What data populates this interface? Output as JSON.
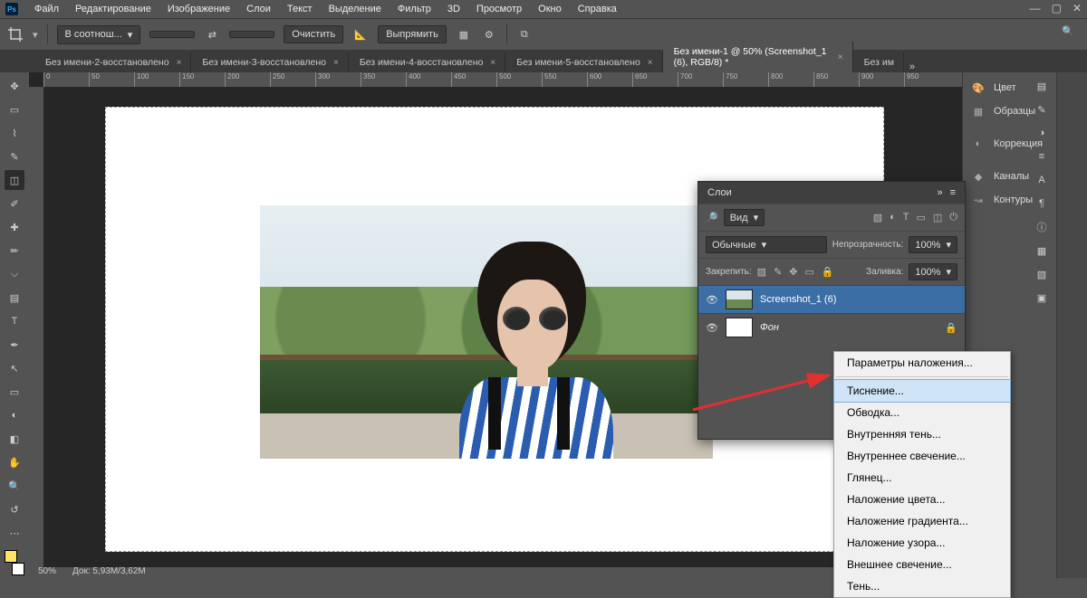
{
  "menu": {
    "items": [
      "Файл",
      "Редактирование",
      "Изображение",
      "Слои",
      "Текст",
      "Выделение",
      "Фильтр",
      "3D",
      "Просмотр",
      "Окно",
      "Справка"
    ]
  },
  "options": {
    "ratio_dd": "В соотнош...",
    "clear": "Очистить",
    "straighten": "Выпрямить"
  },
  "tabs": {
    "items": [
      "Без имени-2-восстановлено",
      "Без имени-3-восстановлено",
      "Без имени-4-восстановлено",
      "Без имени-5-восстановлено",
      "Без имени-1 @ 50% (Screenshot_1 (6), RGB/8) *",
      "Без им"
    ],
    "activeIndex": 4
  },
  "ruler": {
    "marks": [
      "0",
      "50",
      "100",
      "150",
      "200",
      "250",
      "300",
      "350",
      "400",
      "450",
      "500",
      "550",
      "600",
      "650",
      "700",
      "750",
      "800",
      "850",
      "900",
      "950"
    ]
  },
  "rightPanels": {
    "color": "Цвет",
    "swatches": "Образцы",
    "adjustments": "Коррекция",
    "channels": "Каналы",
    "paths": "Контуры"
  },
  "layersPanel": {
    "title": "Слои",
    "kind_label": "Вид",
    "blend": "Обычные",
    "opacity_label": "Непрозрачность:",
    "opacity_value": "100%",
    "lock_label": "Закрепить:",
    "fill_label": "Заливка:",
    "fill_value": "100%",
    "layers": [
      {
        "name": "Screenshot_1 (6)"
      },
      {
        "name": "Фон"
      }
    ]
  },
  "context": {
    "items": [
      "Параметры наложения...",
      "Тиснение...",
      "Обводка...",
      "Внутренняя тень...",
      "Внутреннее свечение...",
      "Глянец...",
      "Наложение цвета...",
      "Наложение градиента...",
      "Наложение узора...",
      "Внешнее свечение...",
      "Тень..."
    ],
    "hoverIndex": 1
  },
  "status": {
    "zoom": "50%",
    "docinfo": "Док: 5,93M/3,62M"
  }
}
